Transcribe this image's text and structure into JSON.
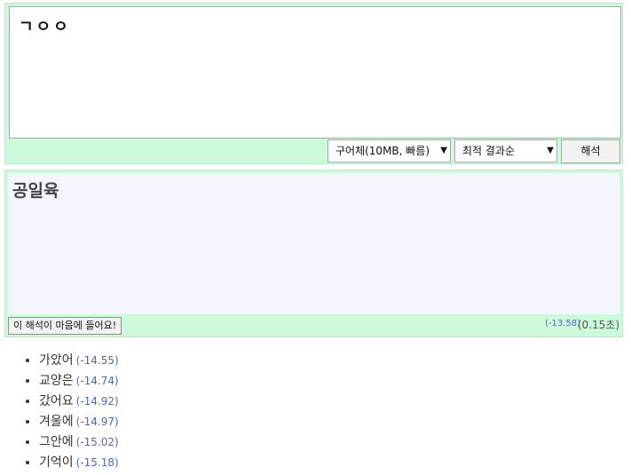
{
  "input": {
    "text": "ㄱㅇㅇ"
  },
  "controls": {
    "model_select": "구어체(10MB, 빠름)",
    "sort_select": "최적 결과순",
    "analyze_label": "해석"
  },
  "result": {
    "text": "공일육",
    "like_label": "이 해석이 마음에 들어요!",
    "score": "(-13.58)",
    "time": "(0.15초)"
  },
  "alternatives": [
    {
      "word": "가았어",
      "score": "(-14.55)"
    },
    {
      "word": "교양은",
      "score": "(-14.74)"
    },
    {
      "word": "갔어요",
      "score": "(-14.92)"
    },
    {
      "word": "겨울에",
      "score": "(-14.97)"
    },
    {
      "word": "그안에",
      "score": "(-15.02)"
    },
    {
      "word": "기억이",
      "score": "(-15.18)"
    }
  ]
}
